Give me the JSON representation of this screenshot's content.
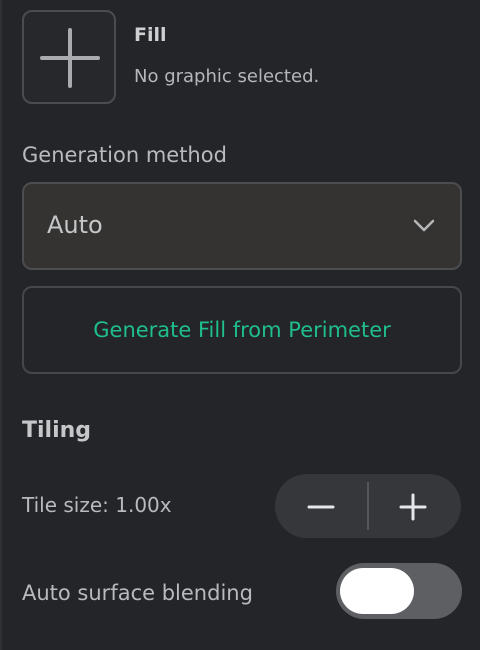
{
  "fill": {
    "title": "Fill",
    "subtitle": "No graphic selected.",
    "thumbnail_icon": "plus-icon"
  },
  "generation": {
    "label": "Generation method",
    "selected": "Auto",
    "dropdown_icon": "chevron-down-icon",
    "generate_button": "Generate Fill from Perimeter"
  },
  "tiling": {
    "heading": "Tiling",
    "tile_size_label": "Tile size: 1.00x",
    "decrease_icon": "minus-icon",
    "increase_icon": "plus-icon",
    "auto_blending_label": "Auto surface blending",
    "auto_blending_on": false
  },
  "colors": {
    "background": "#232528",
    "accent": "#1fbe8a",
    "select_bg": "#353332",
    "toggle_track": "#5d5f63"
  }
}
